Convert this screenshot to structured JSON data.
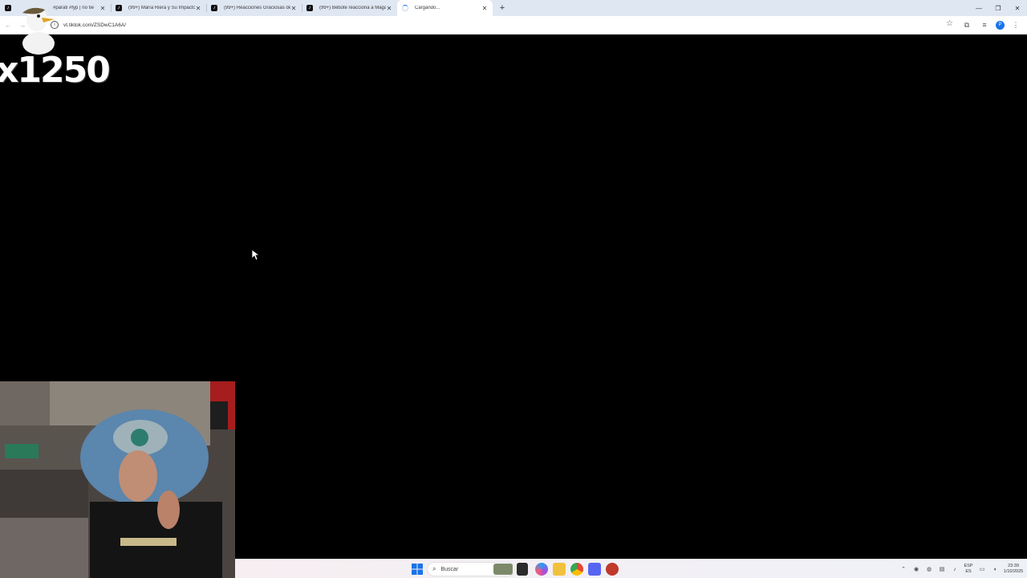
{
  "browser": {
    "tabs": [
      {
        "title": "#parati #fyp | no tie",
        "icon": "tiktok-icon"
      },
      {
        "title": "(99+) María Riera y Su Impacto",
        "icon": "tiktok-icon"
      },
      {
        "title": "(99+) Reacciones Graciosas de",
        "icon": "tiktok-icon"
      },
      {
        "title": "(99+) Bebote reacciona a Maga",
        "icon": "tiktok-icon"
      },
      {
        "title": "Cargando...",
        "icon": "loading-spinner-icon",
        "active": true
      }
    ],
    "new_tab_symbol": "+",
    "url": "vt.tiktok.com/ZSDwC1A6A/",
    "profile_initial": "P"
  },
  "overlay": {
    "counter_text": "x1250"
  },
  "taskbar": {
    "search_label": "Buscar",
    "lang_line1": "ESP",
    "lang_line2": "ES",
    "time": "23:39",
    "date": "1/10/2025"
  },
  "colors": {
    "tabstrip_bg": "#dfe7f3",
    "page_bg": "#000000",
    "accent": "#1a73e8"
  }
}
